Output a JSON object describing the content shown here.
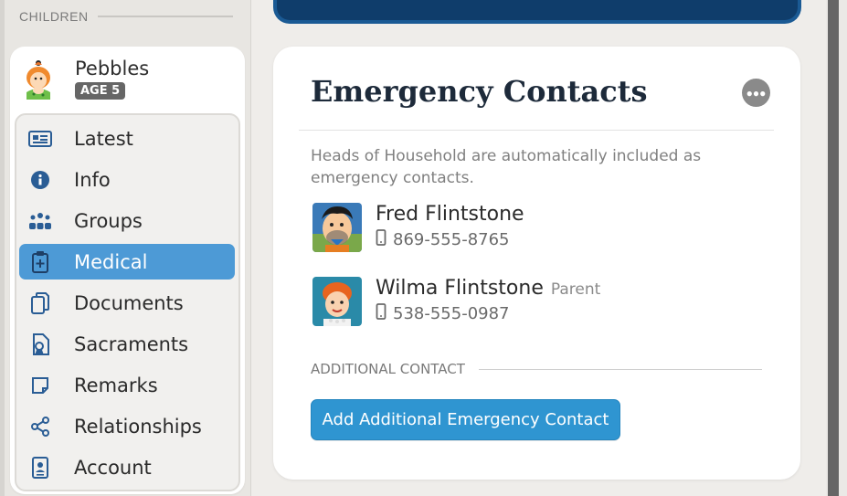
{
  "sidebar": {
    "section_label": "CHILDREN",
    "child": {
      "name": "Pebbles",
      "age_badge": "AGE 5"
    },
    "items": [
      {
        "label": "Latest",
        "icon": "newspaper-icon",
        "active": false
      },
      {
        "label": "Info",
        "icon": "info-circle-icon",
        "active": false
      },
      {
        "label": "Groups",
        "icon": "groups-icon",
        "active": false
      },
      {
        "label": "Medical",
        "icon": "medical-clipboard-icon",
        "active": true
      },
      {
        "label": "Documents",
        "icon": "documents-icon",
        "active": false
      },
      {
        "label": "Sacraments",
        "icon": "sacraments-icon",
        "active": false
      },
      {
        "label": "Remarks",
        "icon": "note-icon",
        "active": false
      },
      {
        "label": "Relationships",
        "icon": "share-nodes-icon",
        "active": false
      },
      {
        "label": "Account",
        "icon": "id-badge-icon",
        "active": false
      }
    ]
  },
  "main": {
    "card": {
      "title": "Emergency Contacts",
      "more_icon": "ellipsis-icon",
      "note": "Heads of Household are automatically included as emergency contacts.",
      "contacts": [
        {
          "name": "Fred Flintstone",
          "relation": "",
          "phone": "869-555-8765"
        },
        {
          "name": "Wilma Flintstone",
          "relation": "Parent",
          "phone": "538-555-0987"
        }
      ],
      "additional_label": "ADDITIONAL CONTACT",
      "add_button": "Add Additional Emergency Contact"
    }
  },
  "colors": {
    "accent": "#4d9ad6",
    "button": "#2f95d1",
    "banner": "#0f3d6b",
    "icon_blue": "#2a5d95"
  }
}
